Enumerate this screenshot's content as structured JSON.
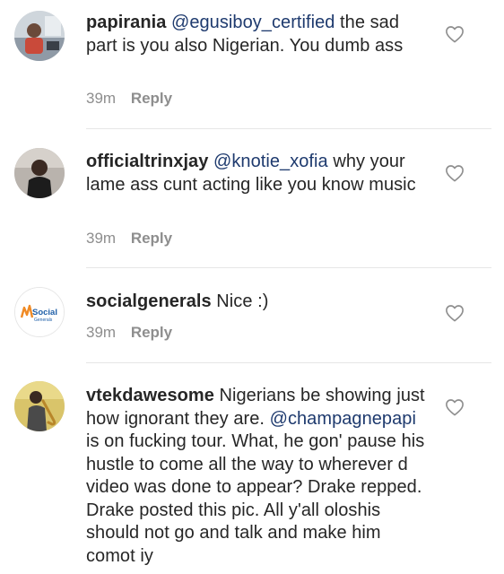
{
  "comments": [
    {
      "username": "papirania",
      "mention": "@egusiboy_certified",
      "text": " the sad part is you also Nigerian. You dumb ass",
      "time": "39m",
      "reply": "Reply",
      "avatar": "person-photo-avatar"
    },
    {
      "username": "officialtrinxjay",
      "mention": "@knotie_xofia",
      "text": " why your lame ass cunt acting like you know music",
      "time": "39m",
      "reply": "Reply",
      "avatar": "person-photo-avatar"
    },
    {
      "username": "socialgenerals",
      "mention": "",
      "text": " Nice :)",
      "time": "39m",
      "reply": "Reply",
      "avatar": "social-generals-logo",
      "logo_text": "Social",
      "logo_sub": "Generals"
    },
    {
      "username": "vtekdawesome",
      "text_parts": [
        " Nigerians be showing just how ignorant they are. ",
        "@champagnepapi",
        " is on fucking tour. What, he gon' pause his hustle to come all the way to wherever d video was done to appear? Drake repped. Drake posted this pic. All y'all oloshis should not go and talk and make him comot iy"
      ],
      "avatar": "saxophone-player-avatar"
    }
  ],
  "icons": {
    "like": "heart-outline-icon"
  },
  "colors": {
    "text": "#262626",
    "mention": "#1e3a6e",
    "meta": "#8e8e8e",
    "divider": "#e6e6e6",
    "logo_blue": "#1f5fa8",
    "logo_orange": "#f08a24"
  }
}
